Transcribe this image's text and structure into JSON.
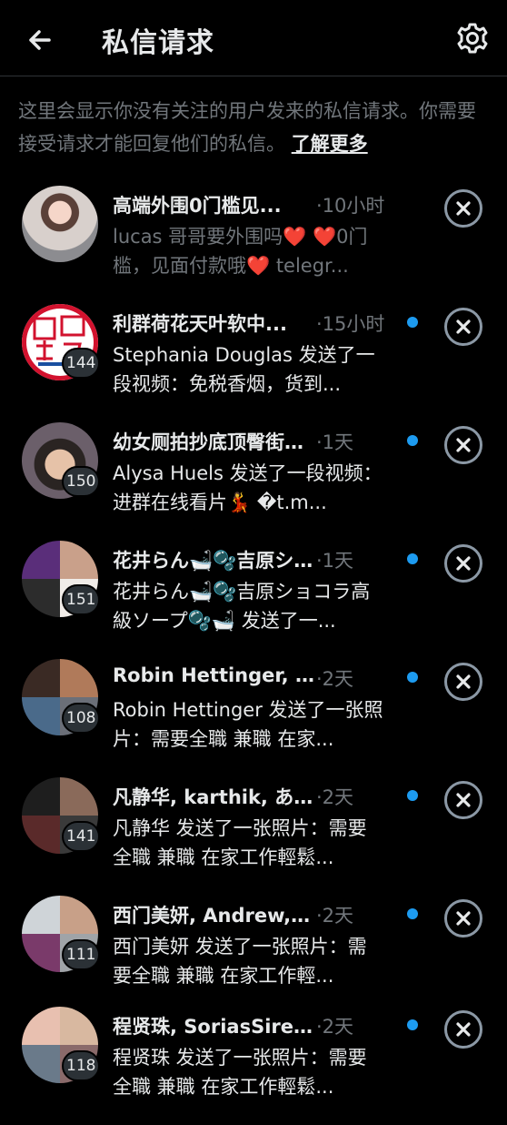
{
  "header": {
    "title": "私信请求"
  },
  "intro": {
    "text": "这里会显示你没有关注的用户发来的私信请求。你需要接受请求才能回复他们的私信。",
    "link": "了解更多"
  },
  "requests": [
    {
      "name": "高端外围0门槛见...",
      "time": "·10小时",
      "unread": false,
      "badge": "",
      "preview": "lucas 哥哥要外围吗❤️ ❤️0门槛，见面付款哦❤️ telegr...",
      "avatar": "photo"
    },
    {
      "name": "利群荷花天叶软中...",
      "time": "·15小时",
      "unread": true,
      "badge": "144",
      "preview": "Stephania Douglas 发送了一段视频：免税香烟，货到...",
      "avatar": "logo"
    },
    {
      "name": "幼女厕拍抄底顶臀街射...",
      "time": "·1天",
      "unread": true,
      "badge": "150",
      "preview": "Alysa Huels 发送了一段视频：进群在线看片💃 �t.m...",
      "avatar": "photo"
    },
    {
      "name": "花井らん🛁🫧吉原シ...",
      "time": "·1天",
      "unread": true,
      "badge": "151",
      "preview": "花井らん🛁🫧吉原ショコラ高級ソープ🫧🛁 发送了一...",
      "avatar": "group"
    },
    {
      "name": "Robin Hettinger, Sky...",
      "time": "·2天",
      "unread": true,
      "badge": "108",
      "preview": "Robin Hettinger 发送了一张照片：需要全職 兼職 在家...",
      "avatar": "group"
    },
    {
      "name": "凡静华, karthik, あら...",
      "time": "·2天",
      "unread": true,
      "badge": "141",
      "preview": "凡静华 发送了一张照片：需要全職 兼職 在家工作輕鬆...",
      "avatar": "group"
    },
    {
      "name": "西门美妍, Andrew, 🦷...",
      "time": "·2天",
      "unread": true,
      "badge": "111",
      "preview": "西门美妍 发送了一张照片：需要全職 兼職 在家工作輕...",
      "avatar": "group"
    },
    {
      "name": "程贤珠, SoriasSire, C...",
      "time": "·2天",
      "unread": true,
      "badge": "118",
      "preview": "程贤珠 发送了一张照片：需要全職 兼職 在家工作輕鬆...",
      "avatar": "group"
    }
  ],
  "colors": {
    "background": "#000000",
    "accent": "#1d9bf0",
    "muted": "#71767b",
    "text": "#e7e9ea"
  }
}
